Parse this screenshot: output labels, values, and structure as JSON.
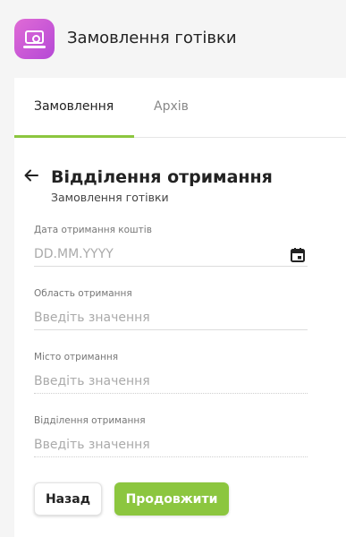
{
  "header": {
    "title": "Замовлення готівки",
    "icon": "cash-order-icon",
    "icon_color": "#c85ad8"
  },
  "tabs": [
    {
      "label": "Замовлення",
      "active": true
    },
    {
      "label": "Архів",
      "active": false
    }
  ],
  "accent_color": "#8cc63f",
  "form": {
    "title": "Відділення отримання",
    "subtitle": "Замовлення готівки",
    "fields": [
      {
        "label": "Дата отримання коштів",
        "placeholder": "DD.MM.YYYY",
        "value": ""
      },
      {
        "label": "Область отримання",
        "placeholder": "Введіть значення",
        "value": ""
      },
      {
        "label": "Місто отримання",
        "placeholder": "Введіть значення",
        "value": ""
      },
      {
        "label": "Відділення отримання",
        "placeholder": "Введіть значення",
        "value": ""
      }
    ],
    "back_button": "Назад",
    "next_button": "Продовжити"
  }
}
